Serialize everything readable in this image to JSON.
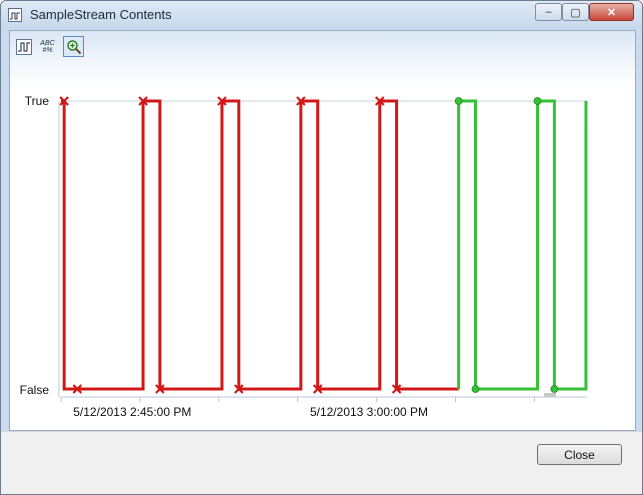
{
  "window": {
    "title": "SampleStream Contents"
  },
  "toolbar": {
    "chart_tool": "chart-view-icon",
    "format_tool_text": "ABC\n#%",
    "zoom_tool": "zoom-in-icon"
  },
  "footer": {
    "close_label": "Close"
  },
  "colors": {
    "red_series": "#d01818",
    "green_series": "#35c035",
    "axis": "#b9c7d8"
  },
  "chart_data": {
    "type": "line",
    "step": true,
    "ylabels": [
      "True",
      "False"
    ],
    "xlabels": [
      "5/12/2013 2:45:00 PM",
      "5/12/2013 3:00:00 PM"
    ],
    "series": [
      {
        "marker": "x",
        "color": "#d01818",
        "points": [
          [
            0,
            1
          ],
          [
            0.6,
            1
          ],
          [
            0.6,
            0
          ],
          [
            15.6,
            0
          ],
          [
            15.6,
            1
          ],
          [
            18.8,
            1
          ],
          [
            18.8,
            0
          ],
          [
            30.6,
            0
          ],
          [
            30.6,
            1
          ],
          [
            33.8,
            1
          ],
          [
            33.8,
            0
          ],
          [
            45.6,
            0
          ],
          [
            45.6,
            1
          ],
          [
            48.8,
            1
          ],
          [
            48.8,
            0
          ],
          [
            60.6,
            0
          ],
          [
            60.6,
            1
          ],
          [
            63.8,
            1
          ],
          [
            63.8,
            0
          ],
          [
            75.6,
            0
          ]
        ],
        "markers": [
          [
            0.6,
            1
          ],
          [
            15.6,
            1
          ],
          [
            30.6,
            1
          ],
          [
            45.6,
            1
          ],
          [
            60.6,
            1
          ],
          [
            3.1,
            0
          ],
          [
            18.8,
            0
          ],
          [
            33.8,
            0
          ],
          [
            48.8,
            0
          ],
          [
            63.8,
            0
          ]
        ]
      },
      {
        "marker": "circle",
        "color": "#35c035",
        "points": [
          [
            75.6,
            0
          ],
          [
            75.6,
            1
          ],
          [
            78.8,
            1
          ],
          [
            78.8,
            0
          ],
          [
            90.6,
            0
          ],
          [
            90.6,
            1
          ],
          [
            93.8,
            1
          ],
          [
            93.8,
            0
          ],
          [
            99.8,
            0
          ],
          [
            99.8,
            1
          ]
        ],
        "markers": [
          [
            75.6,
            1
          ],
          [
            90.6,
            1
          ],
          [
            78.8,
            0
          ],
          [
            93.8,
            0
          ]
        ]
      }
    ],
    "xlabel_ticks": [
      5,
      50
    ]
  }
}
